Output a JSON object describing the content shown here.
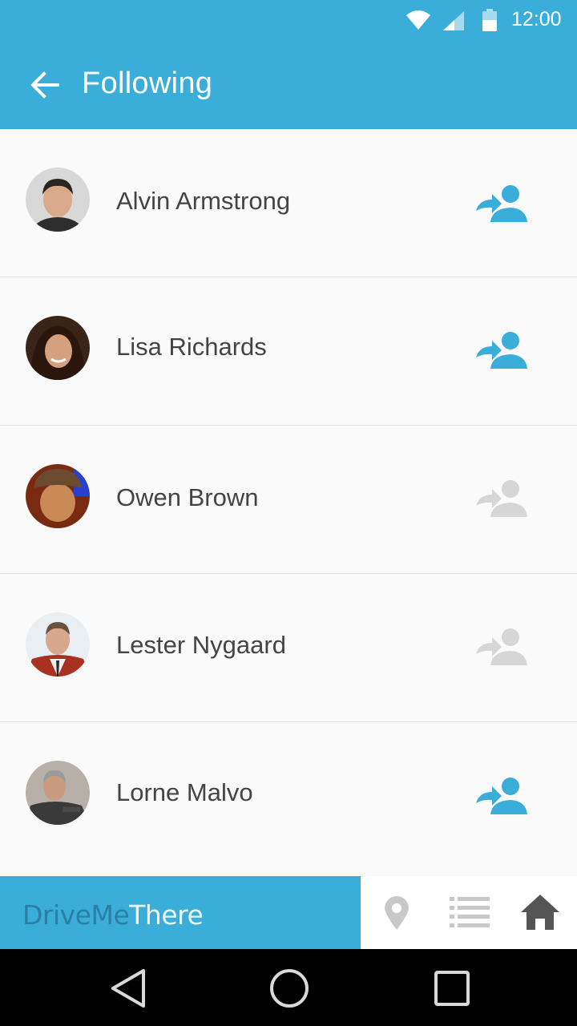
{
  "status_bar": {
    "time": "12:00",
    "icons": [
      "wifi-icon",
      "cell-signal-icon",
      "battery-icon"
    ]
  },
  "app_bar": {
    "back_icon": "arrow-back-icon",
    "title": "Following"
  },
  "following": [
    {
      "name": "Alvin Armstrong",
      "following": true,
      "avatar": "avatar-photo"
    },
    {
      "name": "Lisa Richards",
      "following": true,
      "avatar": "avatar-photo"
    },
    {
      "name": "Owen Brown",
      "following": false,
      "avatar": "avatar-photo"
    },
    {
      "name": "Lester Nygaard",
      "following": false,
      "avatar": "avatar-photo"
    },
    {
      "name": "Lorne Malvo",
      "following": true,
      "avatar": "avatar-photo"
    }
  ],
  "bottom_nav": {
    "brand_part1": "DriveMe",
    "brand_part2": "There",
    "items": [
      {
        "icon": "location-pin-icon"
      },
      {
        "icon": "list-icon"
      },
      {
        "icon": "home-icon"
      }
    ]
  },
  "system_nav": {
    "items": [
      "back-triangle-icon",
      "home-circle-icon",
      "recents-square-icon"
    ]
  },
  "colors": {
    "primary": "#3badd9",
    "brand_dark": "#2b7fa5",
    "follow_active": "#3badd9",
    "follow_inactive": "#d6d6d6",
    "name_text": "#444444",
    "nav_icon_inactive": "#c8c8c8",
    "nav_icon_active": "#555555"
  }
}
